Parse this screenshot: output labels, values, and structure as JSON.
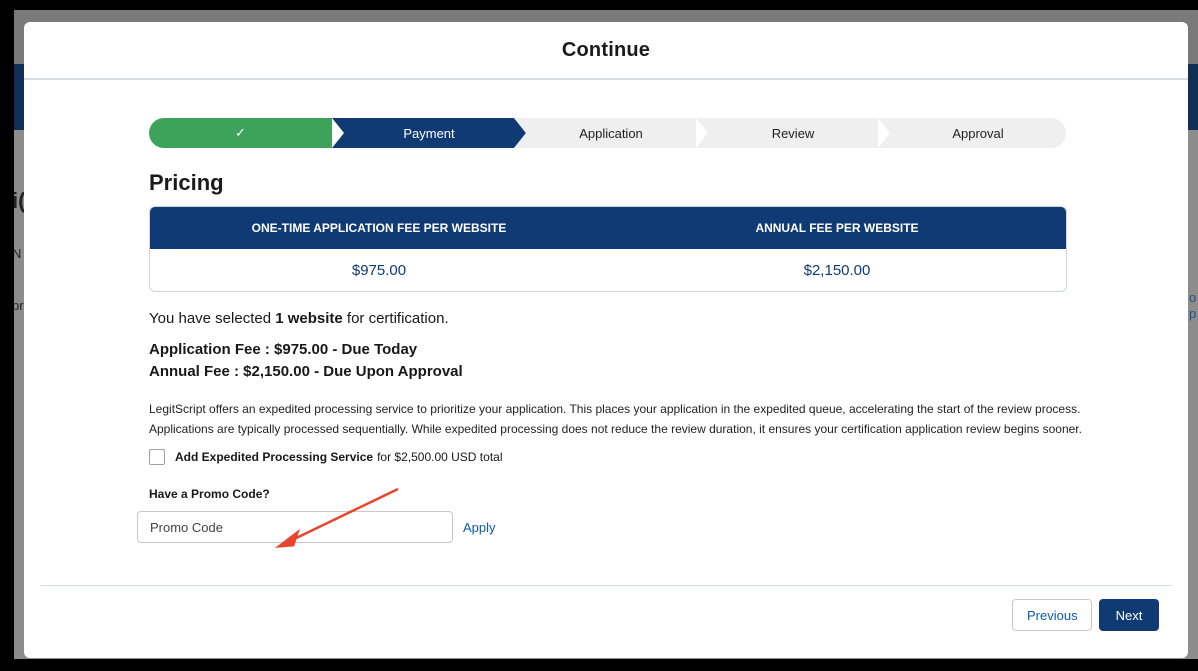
{
  "background": {
    "fragment_left_1": "i(",
    "fragment_left_2": "N",
    "fragment_left_3": "pr",
    "fragment_right_1": "o",
    "fragment_right_2": "p"
  },
  "modal": {
    "title": "Continue"
  },
  "progress": {
    "steps": [
      {
        "label": "✓",
        "state": "complete"
      },
      {
        "label": "Payment",
        "state": "current"
      },
      {
        "label": "Application",
        "state": "incomplete"
      },
      {
        "label": "Review",
        "state": "incomplete"
      },
      {
        "label": "Approval",
        "state": "incomplete"
      }
    ]
  },
  "pricing": {
    "title": "Pricing",
    "columns": [
      "ONE-TIME APPLICATION FEE PER WEBSITE",
      "ANNUAL FEE PER WEBSITE"
    ],
    "values": [
      "$975.00",
      "$2,150.00"
    ]
  },
  "summary": {
    "selected_prefix": "You have selected ",
    "selected_bold": "1 website",
    "selected_suffix": " for certification.",
    "application_fee": "Application Fee : $975.00 - Due Today",
    "annual_fee": "Annual Fee : $2,150.00 - Due Upon Approval"
  },
  "expedited": {
    "description_line1": "LegitScript offers an expedited processing service to prioritize your application. This places your application in the expedited queue, accelerating the start of the review process.",
    "description_line2": "Applications are typically processed sequentially. While expedited processing does not reduce the review duration, it ensures your certification application review begins sooner.",
    "checkbox_bold": "Add Expedited Processing Service",
    "checkbox_rest": "for $2,500.00 USD total",
    "checked": false
  },
  "promo": {
    "label": "Have a Promo Code?",
    "placeholder": "Promo Code",
    "value": "",
    "apply_label": "Apply"
  },
  "footer": {
    "previous_label": "Previous",
    "next_label": "Next"
  },
  "colors": {
    "complete": "#3ea35a",
    "current": "#0f3a73",
    "incomplete": "#efefef",
    "annotation_arrow": "#e8452c"
  }
}
